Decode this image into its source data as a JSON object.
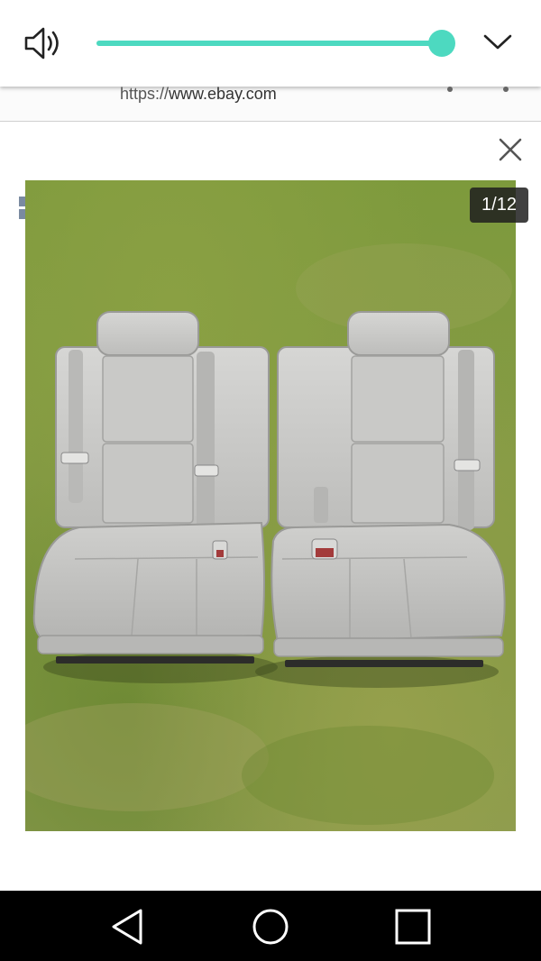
{
  "volume": {
    "level_percent": 100,
    "track_color": "#4dd9c0",
    "icons": {
      "speaker": "speaker-volume-icon",
      "expand": "chevron-down-icon"
    }
  },
  "browser": {
    "url_scheme": "https://",
    "url_host": "www.ebay.com"
  },
  "viewer": {
    "counter": "1/12",
    "icons": {
      "close": "close-icon",
      "gallery": "grid-icon"
    },
    "photo": "two-gray-leather-rear-seats-on-grass"
  },
  "navigation": {
    "icons": [
      "back-triangle-icon",
      "home-circle-icon",
      "recents-square-icon"
    ]
  }
}
